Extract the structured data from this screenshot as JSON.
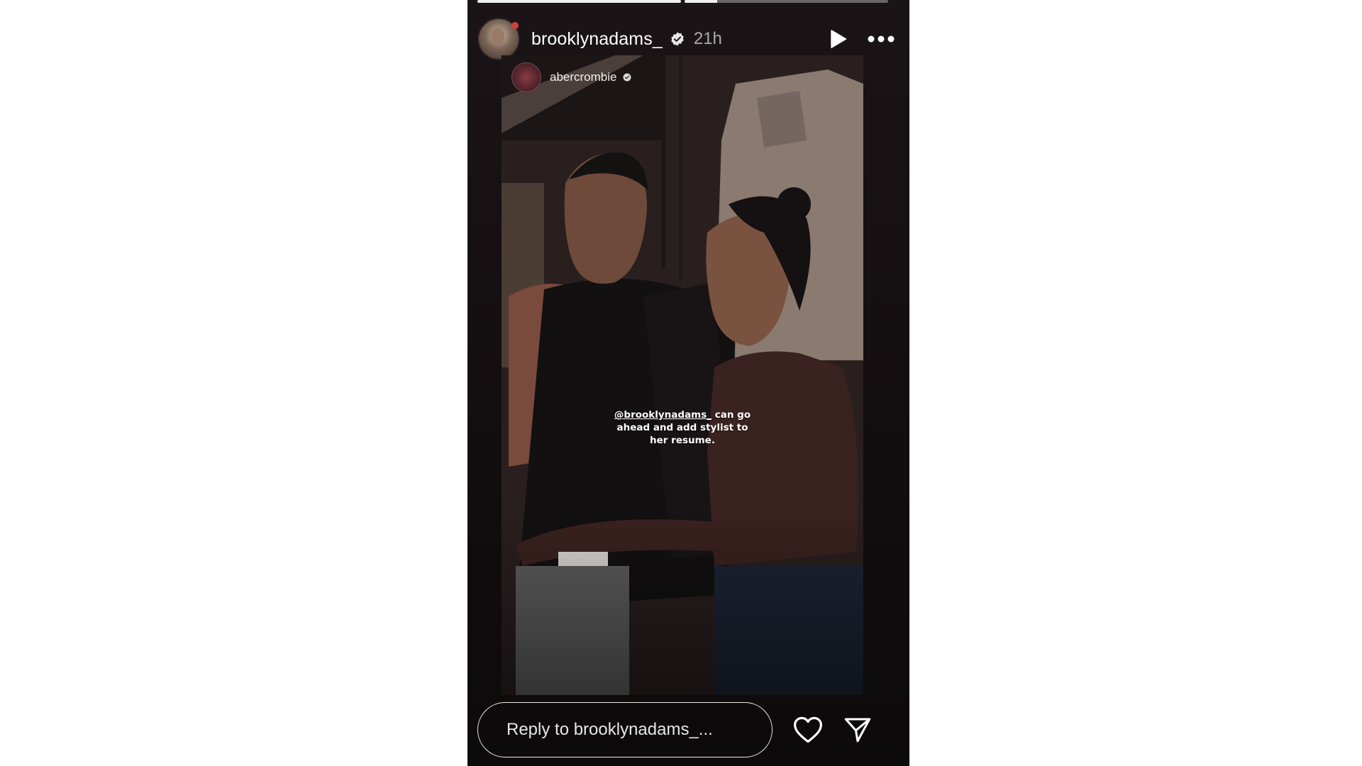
{
  "story": {
    "progress": [
      1.0,
      0.16
    ],
    "header": {
      "username": "brooklynadams_",
      "time_ago": "21h",
      "verified_icon": "verified-badge-icon",
      "play_icon": "play-icon",
      "more_icon": "more-icon"
    },
    "reshare": {
      "source_name": "abercrombie",
      "caption_mention": "@brooklynadams_",
      "caption_rest": " can go ahead and add stylist to her resume."
    },
    "footer": {
      "reply_placeholder": "Reply to brooklynadams_...",
      "like_icon": "heart-icon",
      "share_icon": "send-icon"
    }
  },
  "colors": {
    "story_background": "#120d0f",
    "page_background": "#ffffff",
    "text": "#ffffff",
    "muted_text": "#a9a9a9"
  }
}
